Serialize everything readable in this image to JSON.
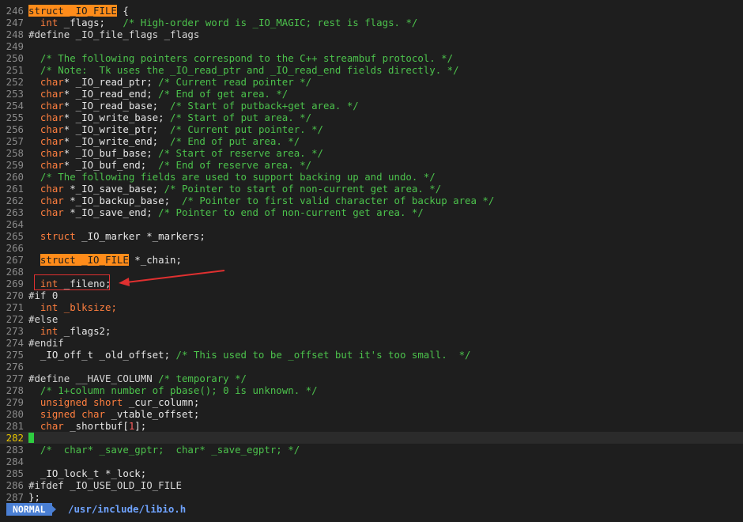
{
  "editor": {
    "lines": [
      {
        "n": "246",
        "t": [
          [
            "hl",
            "struct _IO_FILE"
          ],
          [
            "plain",
            " {"
          ]
        ]
      },
      {
        "n": "247",
        "t": [
          [
            "typ",
            "  int"
          ],
          [
            "plain",
            " _flags;   "
          ],
          [
            "cmt",
            "/* High-order word is _IO_MAGIC; rest is flags. */"
          ]
        ]
      },
      {
        "n": "248",
        "t": [
          [
            "pp",
            "#define _IO_file_flags _flags"
          ]
        ]
      },
      {
        "n": "249",
        "t": []
      },
      {
        "n": "250",
        "t": [
          [
            "cmt",
            "  /* The following pointers correspond to the C++ streambuf protocol. */"
          ]
        ]
      },
      {
        "n": "251",
        "t": [
          [
            "cmt",
            "  /* Note:  Tk uses the _IO_read_ptr and _IO_read_end fields directly. */"
          ]
        ]
      },
      {
        "n": "252",
        "t": [
          [
            "typ",
            "  char"
          ],
          [
            "plain",
            "* _IO_read_ptr; "
          ],
          [
            "cmt",
            "/* Current read pointer */"
          ]
        ]
      },
      {
        "n": "253",
        "t": [
          [
            "typ",
            "  char"
          ],
          [
            "plain",
            "* _IO_read_end; "
          ],
          [
            "cmt",
            "/* End of get area. */"
          ]
        ]
      },
      {
        "n": "254",
        "t": [
          [
            "typ",
            "  char"
          ],
          [
            "plain",
            "* _IO_read_base;  "
          ],
          [
            "cmt",
            "/* Start of putback+get area. */"
          ]
        ]
      },
      {
        "n": "255",
        "t": [
          [
            "typ",
            "  char"
          ],
          [
            "plain",
            "* _IO_write_base; "
          ],
          [
            "cmt",
            "/* Start of put area. */"
          ]
        ]
      },
      {
        "n": "256",
        "t": [
          [
            "typ",
            "  char"
          ],
          [
            "plain",
            "* _IO_write_ptr;  "
          ],
          [
            "cmt",
            "/* Current put pointer. */"
          ]
        ]
      },
      {
        "n": "257",
        "t": [
          [
            "typ",
            "  char"
          ],
          [
            "plain",
            "* _IO_write_end;  "
          ],
          [
            "cmt",
            "/* End of put area. */"
          ]
        ]
      },
      {
        "n": "258",
        "t": [
          [
            "typ",
            "  char"
          ],
          [
            "plain",
            "* _IO_buf_base; "
          ],
          [
            "cmt",
            "/* Start of reserve area. */"
          ]
        ]
      },
      {
        "n": "259",
        "t": [
          [
            "typ",
            "  char"
          ],
          [
            "plain",
            "* _IO_buf_end;  "
          ],
          [
            "cmt",
            "/* End of reserve area. */"
          ]
        ]
      },
      {
        "n": "260",
        "t": [
          [
            "cmt",
            "  /* The following fields are used to support backing up and undo. */"
          ]
        ]
      },
      {
        "n": "261",
        "t": [
          [
            "typ",
            "  char"
          ],
          [
            "plain",
            " *_IO_save_base; "
          ],
          [
            "cmt",
            "/* Pointer to start of non-current get area. */"
          ]
        ]
      },
      {
        "n": "262",
        "t": [
          [
            "typ",
            "  char"
          ],
          [
            "plain",
            " *_IO_backup_base;  "
          ],
          [
            "cmt",
            "/* Pointer to first valid character of backup area */"
          ]
        ]
      },
      {
        "n": "263",
        "t": [
          [
            "typ",
            "  char"
          ],
          [
            "plain",
            " *_IO_save_end; "
          ],
          [
            "cmt",
            "/* Pointer to end of non-current get area. */"
          ]
        ]
      },
      {
        "n": "264",
        "t": []
      },
      {
        "n": "265",
        "t": [
          [
            "typ",
            "  struct"
          ],
          [
            "plain",
            " _IO_marker *_markers;"
          ]
        ]
      },
      {
        "n": "266",
        "t": []
      },
      {
        "n": "267",
        "t": [
          [
            "plain",
            "  "
          ],
          [
            "hl",
            "struct _IO_FILE"
          ],
          [
            "plain",
            " *_chain;"
          ]
        ]
      },
      {
        "n": "268",
        "t": []
      },
      {
        "n": "269",
        "t": [
          [
            "typ",
            "  int"
          ],
          [
            "plain",
            " _fileno;"
          ]
        ]
      },
      {
        "n": "270",
        "t": [
          [
            "pp",
            "#if 0"
          ]
        ]
      },
      {
        "n": "271",
        "t": [
          [
            "typ",
            "  int"
          ],
          [
            "typ",
            " _blksize;"
          ]
        ]
      },
      {
        "n": "272",
        "t": [
          [
            "pp",
            "#else"
          ]
        ]
      },
      {
        "n": "273",
        "t": [
          [
            "typ",
            "  int"
          ],
          [
            "plain",
            " _flags2;"
          ]
        ]
      },
      {
        "n": "274",
        "t": [
          [
            "pp",
            "#endif"
          ]
        ]
      },
      {
        "n": "275",
        "t": [
          [
            "plain",
            "  _IO_off_t _old_offset; "
          ],
          [
            "cmt",
            "/* This used to be _offset but it's too small.  */"
          ]
        ]
      },
      {
        "n": "276",
        "t": []
      },
      {
        "n": "277",
        "t": [
          [
            "pp",
            "#define __HAVE_COLUMN "
          ],
          [
            "cmt",
            "/* temporary */"
          ]
        ]
      },
      {
        "n": "278",
        "t": [
          [
            "cmt",
            "  /* 1+column number of pbase(); 0 is unknown. */"
          ]
        ]
      },
      {
        "n": "279",
        "t": [
          [
            "typ",
            "  unsigned short"
          ],
          [
            "plain",
            " _cur_column;"
          ]
        ]
      },
      {
        "n": "280",
        "t": [
          [
            "typ",
            "  signed char"
          ],
          [
            "plain",
            " _vtable_offset;"
          ]
        ]
      },
      {
        "n": "281",
        "t": [
          [
            "typ",
            "  char"
          ],
          [
            "plain",
            " _shortbuf["
          ],
          [
            "num",
            "1"
          ],
          [
            "plain",
            "];"
          ]
        ]
      },
      {
        "n": "282",
        "t": [],
        "current": true
      },
      {
        "n": "283",
        "t": [
          [
            "cmt",
            "  /*  char* _save_gptr;  char* _save_egptr; */"
          ]
        ]
      },
      {
        "n": "284",
        "t": []
      },
      {
        "n": "285",
        "t": [
          [
            "plain",
            "  _IO_lock_t *_lock;"
          ]
        ]
      },
      {
        "n": "286",
        "t": [
          [
            "pp",
            "#ifdef _IO_USE_OLD_IO_FILE"
          ]
        ]
      },
      {
        "n": "287",
        "t": [
          [
            "plain",
            "};"
          ]
        ]
      }
    ]
  },
  "statusline": {
    "mode": "NORMAL",
    "filepath": "/usr/include/libio.h"
  },
  "colors": {
    "background": "#1e1e1e",
    "comment": "#4cc24c",
    "type": "#ff7f3f",
    "highlight": "#ff8c1a",
    "annotation": "#e03030",
    "mode_bg": "#4a7fd4"
  }
}
